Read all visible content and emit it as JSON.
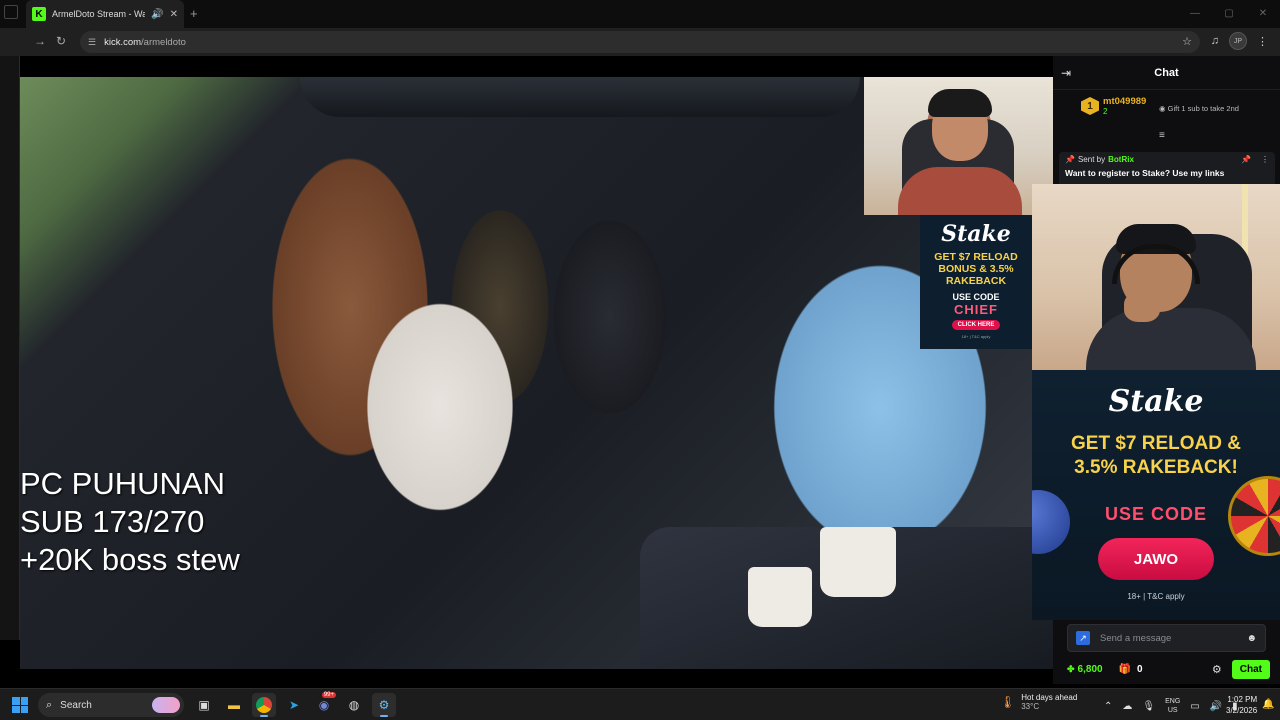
{
  "browser": {
    "tab_title": "ArmelDoto Stream - Watch",
    "tab_favicon": "K",
    "url_host": "kick.com",
    "url_path": "/armeldoto",
    "profile_initials": "JP"
  },
  "stream": {
    "overlay_lines": [
      "PC PUHUNAN",
      "SUB 173/270",
      "+20K boss stew"
    ]
  },
  "ad_small": {
    "logo": "Stake",
    "promo": "GET $7 RELOAD BONUS & 3.5% RAKEBACK",
    "code_label": "USE CODE",
    "code": "CHIEF",
    "button": "CLICK HERE",
    "fine": "18+ | T&C apply"
  },
  "chat": {
    "title": "Chat",
    "top_gifter": {
      "rank": "1",
      "name": "mt049989",
      "count": "2",
      "hint": "Gift 1 sub to take 2nd"
    },
    "pinned": {
      "sent_by_label": "Sent by",
      "sender": "BotRix",
      "text": "Want to register to Stake? Use my links"
    },
    "input_placeholder": "Send a message",
    "points": "6,800",
    "gifts": "0",
    "send_label": "Chat"
  },
  "ad_big": {
    "logo": "Stake",
    "promo_line1": "GET $7 RELOAD &",
    "promo_line2": "3.5% RAKEBACK!",
    "code_label": "USE CODE",
    "code": "JAWO",
    "fine": "18+ | T&C apply"
  },
  "taskbar": {
    "search_label": "Search",
    "weather_title": "Hot days ahead",
    "weather_temp": "33°C",
    "lang_line1": "ENG",
    "lang_line2": "US",
    "time": "1:02 PM",
    "date": "3/2/2026",
    "chat_badge": "99+"
  },
  "colors": {
    "kick_green": "#53fc18",
    "stake_gold": "#f8d24b",
    "stake_pink": "#e0104a",
    "accent_blue": "#3aa0f3"
  }
}
